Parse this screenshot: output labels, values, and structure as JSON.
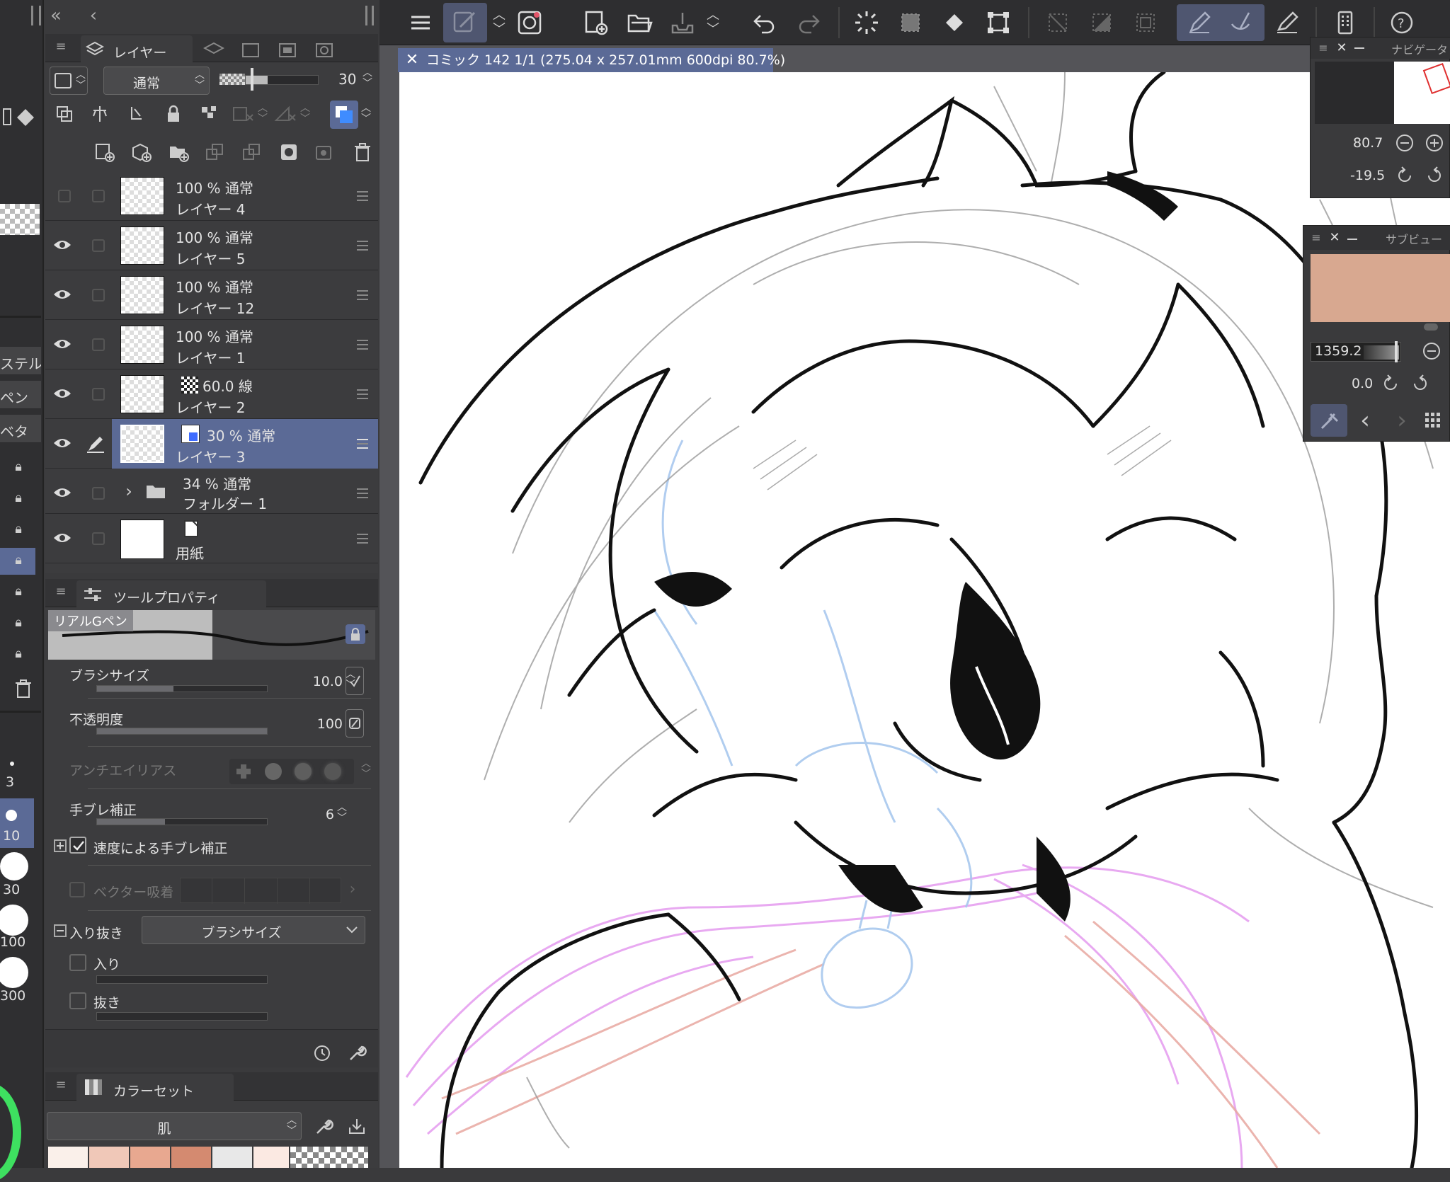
{
  "document_tab": {
    "title": "コミック 142 1/1 (275.04 x 257.01mm 600dpi 80.7%)"
  },
  "layer_panel": {
    "tab_label": "レイヤー",
    "blend_mode": "通常",
    "opacity_value": "30",
    "layers": [
      {
        "line1": "100 % 通常",
        "line2": "レイヤー 4",
        "visible": false,
        "selected": false
      },
      {
        "line1": "100 % 通常",
        "line2": "レイヤー 5",
        "visible": true,
        "selected": false
      },
      {
        "line1": "100 % 通常",
        "line2": "レイヤー 12",
        "visible": true,
        "selected": false
      },
      {
        "line1": "100 % 通常",
        "line2": "レイヤー 1",
        "visible": true,
        "selected": false
      },
      {
        "line1": "60.0 線",
        "line2": "レイヤー 2",
        "visible": true,
        "selected": false
      },
      {
        "line1": "30 % 通常",
        "line2": "レイヤー 3",
        "visible": true,
        "selected": true
      },
      {
        "line1": "34 % 通常",
        "line2": "フォルダー 1",
        "visible": true,
        "selected": false
      },
      {
        "line1": "",
        "line2": "用紙",
        "visible": true,
        "selected": false
      }
    ]
  },
  "tool_property": {
    "tab_label": "ツールプロパティ",
    "tool_name": "リアルGペン",
    "brush_size_label": "ブラシサイズ",
    "brush_size_value": "10.0",
    "opacity_label": "不透明度",
    "opacity_value": "100",
    "antialias_label": "アンチエイリアス",
    "stabilization_label": "手ブレ補正",
    "stabilization_value": "6",
    "speed_stabilization_label": "速度による手ブレ補正",
    "vector_snap_label": "ベクター吸着",
    "taper_label": "入り抜き",
    "taper_select": "ブラシサイズ",
    "taper_in_label": "入り",
    "taper_out_label": "抜き"
  },
  "color_set": {
    "tab_label": "カラーセット",
    "set_name": "肌",
    "swatches": [
      "#faf0ea",
      "#f0c8b8",
      "#e8a890",
      "#d48a70",
      "#e8e8e8",
      "#fbe9e2"
    ]
  },
  "left_strip": {
    "items": [
      "ステル",
      "ペン",
      "ベタ"
    ],
    "brush_sizes": [
      "3",
      "10",
      "30",
      "100",
      "300"
    ]
  },
  "navigator": {
    "title": "ナビゲータ",
    "zoom": "80.7",
    "rotation": "-19.5"
  },
  "sub_view": {
    "title": "サブビュー",
    "zoom": "1359.2",
    "rotation": "0.0",
    "color": "#d8a890"
  },
  "colors": {
    "selected_row": "#5b6a96",
    "panel_bg": "#3c3c3e",
    "toolbar_bg": "#2e2e30",
    "accent_green": "#3ee060"
  }
}
